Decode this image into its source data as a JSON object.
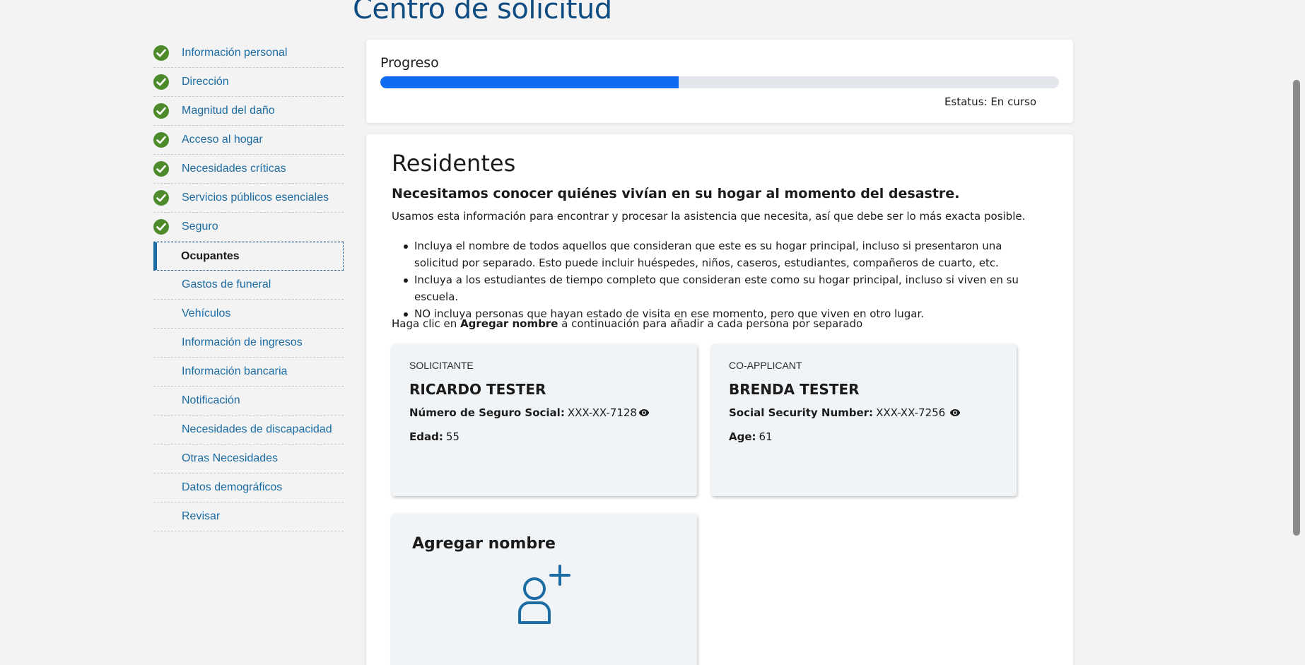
{
  "header": {
    "title": "Centro de solicitud"
  },
  "sidebar": {
    "items": [
      {
        "label": "Información personal",
        "completed": true
      },
      {
        "label": "Dirección",
        "completed": true
      },
      {
        "label": "Magnitud del daño",
        "completed": true
      },
      {
        "label": "Acceso al hogar",
        "completed": true
      },
      {
        "label": "Necesidades críticas",
        "completed": true
      },
      {
        "label": "Servicios públicos esenciales",
        "completed": true
      },
      {
        "label": "Seguro",
        "completed": true
      },
      {
        "label": "Ocupantes",
        "completed": false,
        "active": true
      },
      {
        "label": "Gastos de funeral",
        "completed": false
      },
      {
        "label": "Vehículos",
        "completed": false
      },
      {
        "label": "Información de ingresos",
        "completed": false
      },
      {
        "label": "Información bancaria",
        "completed": false
      },
      {
        "label": "Notificación",
        "completed": false
      },
      {
        "label": "Necesidades de discapacidad",
        "completed": false
      },
      {
        "label": "Otras Necesidades",
        "completed": false
      },
      {
        "label": "Datos demográficos",
        "completed": false
      },
      {
        "label": "Revisar",
        "completed": false
      }
    ]
  },
  "progress": {
    "title": "Progreso",
    "percent": 44,
    "status": "Estatus: En curso"
  },
  "main": {
    "title": "Residentes",
    "subtitle": "Necesitamos conocer quiénes vivían en su hogar al momento del desastre.",
    "intro": "Usamos esta información para encontrar y procesar la asistencia que necesita, así que debe ser lo más exacta posible.",
    "bullets": [
      "Incluya el nombre de todos aquellos que consideran que este es su hogar principal, incluso si presentaron una solicitud por separado. Esto puede incluir huéspedes, niños, caseros, estudiantes, compañeros de cuarto, etc.",
      "Incluya a los estudiantes de tiempo completo que consideran este como su hogar principal, incluso si viven en su escuela.",
      "NO incluya personas que hayan estado de visita en ese momento, pero que viven en otro lugar."
    ],
    "instruction_pre": "Haga clic en ",
    "instruction_bold": "Agregar nombre",
    "instruction_post": " a continuación para añadir a cada persona por separado"
  },
  "residents": [
    {
      "role": "SOLICITANTE",
      "name": "RICARDO TESTER",
      "ssn_label": "Número de Seguro Social:",
      "ssn_value": "XXX-XX-7128",
      "age_label": "Edad:",
      "age_value": "55"
    },
    {
      "role": "CO-APPLICANT",
      "name": "BRENDA TESTER",
      "ssn_label": "Social Security Number:",
      "ssn_value": "XXX-XX-7256",
      "age_label": "Age:",
      "age_value": "61"
    }
  ],
  "add_card": {
    "title": "Agregar nombre",
    "icon": "add-person-icon"
  },
  "colors": {
    "accent": "#0f6bef",
    "link": "#1a6ca3",
    "title": "#0f4c81",
    "check": "#4d8a2a"
  }
}
